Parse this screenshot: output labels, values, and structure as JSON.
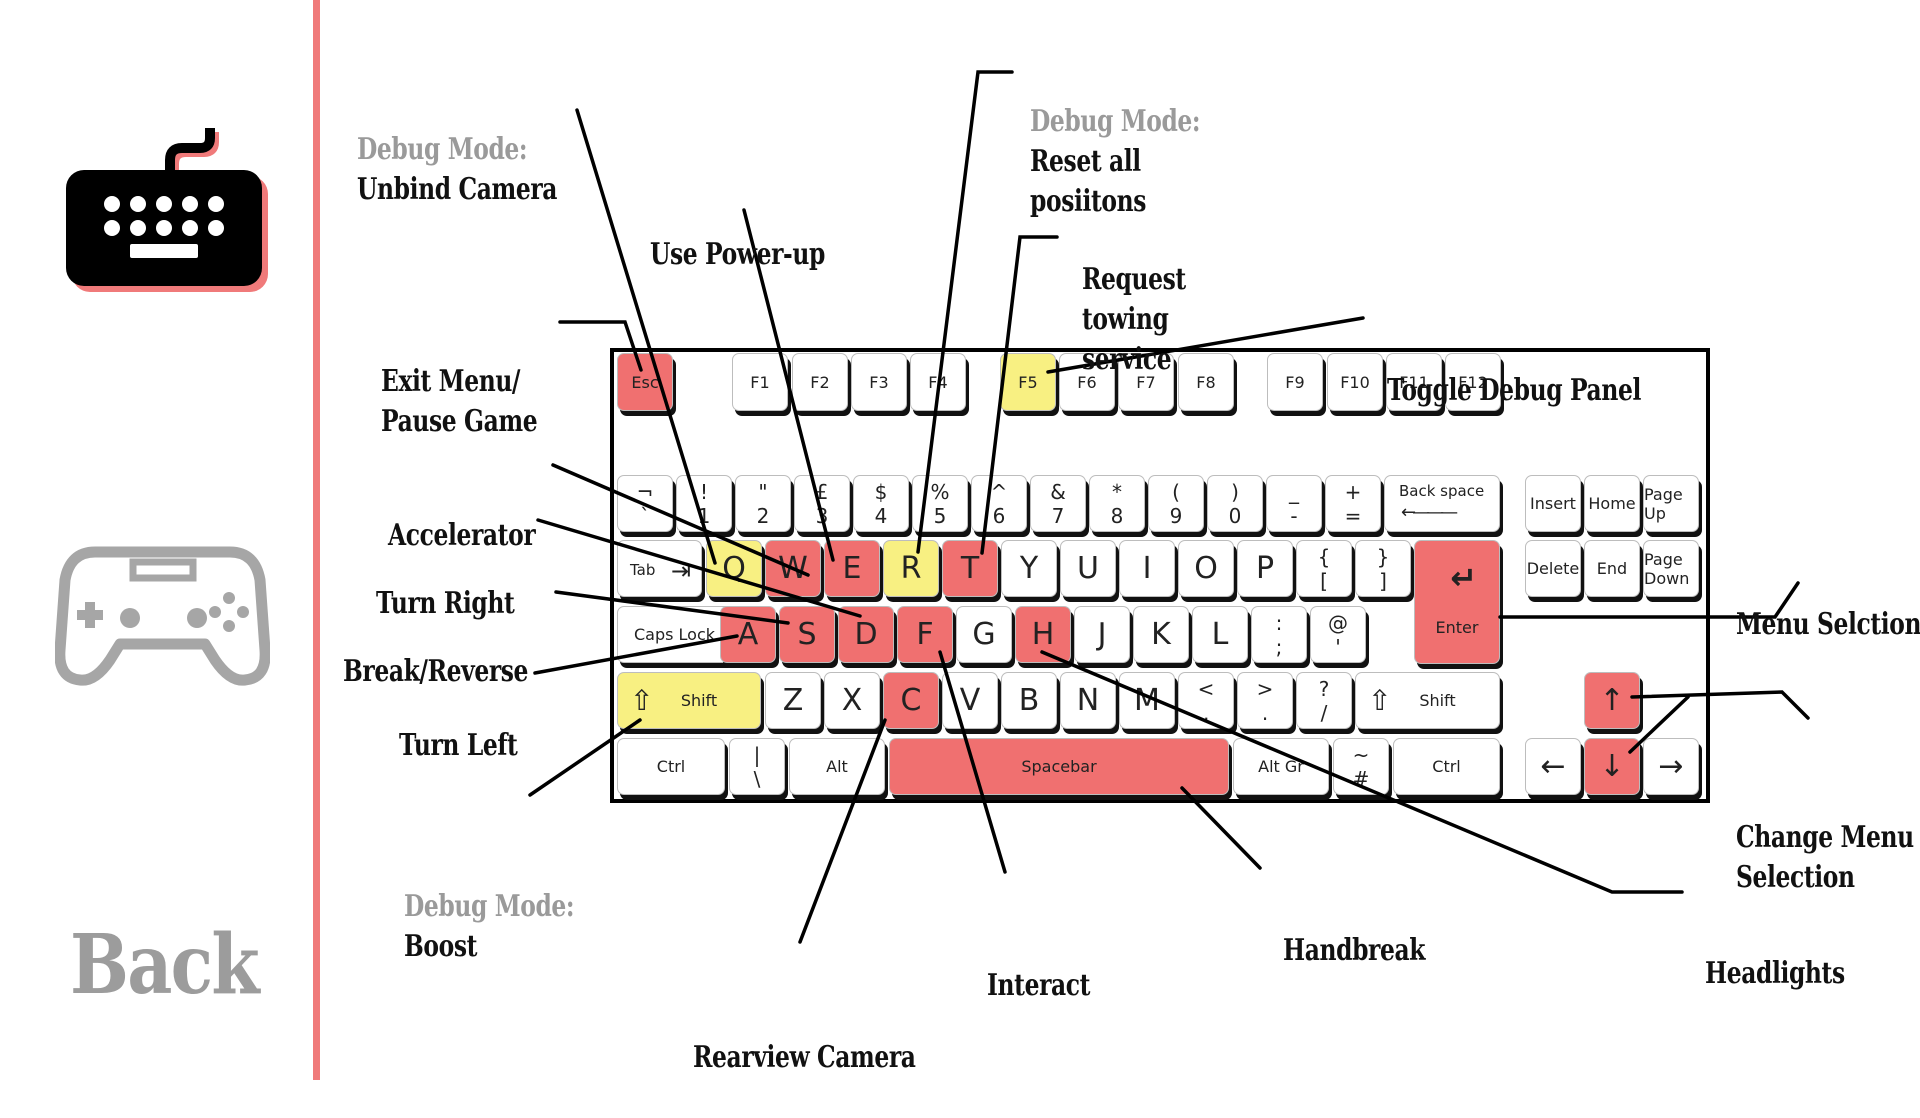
{
  "sidebar": {
    "keyboard_icon": "keyboard-icon",
    "gamepad_icon": "gamepad-icon",
    "back_label": "Back",
    "accent": "#f07a7a"
  },
  "colors": {
    "action_key": "#f07070",
    "debug_key": "#f8f082",
    "debug_text": "#9a9a9a"
  },
  "keyboard": {
    "keys": [
      {
        "id": "esc",
        "label": "Esc",
        "style": "small",
        "color": "red"
      },
      {
        "id": "f1",
        "label": "F1",
        "style": "small"
      },
      {
        "id": "f2",
        "label": "F2",
        "style": "small"
      },
      {
        "id": "f3",
        "label": "F3",
        "style": "small"
      },
      {
        "id": "f4",
        "label": "F4",
        "style": "small"
      },
      {
        "id": "f5",
        "label": "F5",
        "style": "small",
        "color": "yel"
      },
      {
        "id": "f6",
        "label": "F6",
        "style": "small"
      },
      {
        "id": "f7",
        "label": "F7",
        "style": "small"
      },
      {
        "id": "f8",
        "label": "F8",
        "style": "small"
      },
      {
        "id": "f9",
        "label": "F9",
        "style": "small"
      },
      {
        "id": "f10",
        "label": "F10",
        "style": "small"
      },
      {
        "id": "f11",
        "label": "F11",
        "style": "small"
      },
      {
        "id": "f12",
        "label": "F12",
        "style": "small"
      },
      {
        "id": "backtick",
        "top": "¬",
        "bottom": "`",
        "style": "dual"
      },
      {
        "id": "1",
        "top": "!",
        "bottom": "1",
        "style": "dual"
      },
      {
        "id": "2",
        "top": "\"",
        "bottom": "2",
        "style": "dual"
      },
      {
        "id": "3",
        "top": "£",
        "bottom": "3",
        "style": "dual"
      },
      {
        "id": "4",
        "top": "$",
        "bottom": "4",
        "style": "dual"
      },
      {
        "id": "5",
        "top": "%",
        "bottom": "5",
        "style": "dual"
      },
      {
        "id": "6",
        "top": "^",
        "bottom": "6",
        "style": "dual"
      },
      {
        "id": "7",
        "top": "&",
        "bottom": "7",
        "style": "dual"
      },
      {
        "id": "8",
        "top": "*",
        "bottom": "8",
        "style": "dual"
      },
      {
        "id": "9",
        "top": "(",
        "bottom": "9",
        "style": "dual"
      },
      {
        "id": "0",
        "top": ")",
        "bottom": "0",
        "style": "dual"
      },
      {
        "id": "minus",
        "top": "_",
        "bottom": "-",
        "style": "dual"
      },
      {
        "id": "equals",
        "top": "+",
        "bottom": "=",
        "style": "dual"
      },
      {
        "id": "backspace",
        "label": "Back space",
        "style": "backspace"
      },
      {
        "id": "insert",
        "label": "Insert",
        "style": "small"
      },
      {
        "id": "home",
        "label": "Home",
        "style": "small"
      },
      {
        "id": "pageup",
        "label": "Page Up",
        "style": "small"
      },
      {
        "id": "tab",
        "label": "Tab",
        "style": "tab"
      },
      {
        "id": "q",
        "label": "Q",
        "style": "single",
        "color": "yel"
      },
      {
        "id": "w",
        "label": "W",
        "style": "single",
        "color": "red"
      },
      {
        "id": "e",
        "label": "E",
        "style": "single",
        "color": "red"
      },
      {
        "id": "r",
        "label": "R",
        "style": "single",
        "color": "yel"
      },
      {
        "id": "t",
        "label": "T",
        "style": "single",
        "color": "red"
      },
      {
        "id": "y",
        "label": "Y",
        "style": "single"
      },
      {
        "id": "u",
        "label": "U",
        "style": "single"
      },
      {
        "id": "i",
        "label": "I",
        "style": "single"
      },
      {
        "id": "o",
        "label": "O",
        "style": "single"
      },
      {
        "id": "p",
        "label": "P",
        "style": "single"
      },
      {
        "id": "lbrace",
        "top": "{",
        "bottom": "[",
        "style": "dual"
      },
      {
        "id": "rbrace",
        "top": "}",
        "bottom": "]",
        "style": "dual"
      },
      {
        "id": "enter",
        "label": "Enter",
        "style": "enter",
        "color": "red"
      },
      {
        "id": "delete",
        "label": "Delete",
        "style": "small"
      },
      {
        "id": "end",
        "label": "End",
        "style": "small"
      },
      {
        "id": "pagedown",
        "label": "Page Down",
        "style": "small"
      },
      {
        "id": "capslock",
        "label": "Caps Lock",
        "style": "small"
      },
      {
        "id": "a",
        "label": "A",
        "style": "single",
        "color": "red"
      },
      {
        "id": "s",
        "label": "S",
        "style": "single",
        "color": "red"
      },
      {
        "id": "d",
        "label": "D",
        "style": "single",
        "color": "red"
      },
      {
        "id": "f",
        "label": "F",
        "style": "single",
        "color": "red"
      },
      {
        "id": "g",
        "label": "G",
        "style": "single"
      },
      {
        "id": "h",
        "label": "H",
        "style": "single",
        "color": "red"
      },
      {
        "id": "j",
        "label": "J",
        "style": "single"
      },
      {
        "id": "k",
        "label": "K",
        "style": "single"
      },
      {
        "id": "l",
        "label": "L",
        "style": "single"
      },
      {
        "id": "semicolon",
        "top": ":",
        "bottom": ";",
        "style": "dual"
      },
      {
        "id": "quote",
        "top": "@",
        "bottom": "'",
        "style": "dual"
      },
      {
        "id": "lshift",
        "label": "Shift",
        "style": "shift",
        "color": "yel"
      },
      {
        "id": "z",
        "label": "Z",
        "style": "single"
      },
      {
        "id": "x",
        "label": "X",
        "style": "single"
      },
      {
        "id": "c",
        "label": "C",
        "style": "single",
        "color": "red"
      },
      {
        "id": "v",
        "label": "V",
        "style": "single"
      },
      {
        "id": "b",
        "label": "B",
        "style": "single"
      },
      {
        "id": "n",
        "label": "N",
        "style": "single"
      },
      {
        "id": "m",
        "label": "M",
        "style": "single"
      },
      {
        "id": "comma",
        "top": "<",
        "bottom": ",",
        "style": "dual"
      },
      {
        "id": "period",
        "top": ">",
        "bottom": ".",
        "style": "dual"
      },
      {
        "id": "slash",
        "top": "?",
        "bottom": "/",
        "style": "dual"
      },
      {
        "id": "rshift",
        "label": "Shift",
        "style": "shift"
      },
      {
        "id": "up",
        "label": "↑",
        "style": "arrow",
        "color": "red"
      },
      {
        "id": "lctrl",
        "label": "Ctrl",
        "style": "small"
      },
      {
        "id": "pipe",
        "top": "|",
        "bottom": "\\",
        "style": "dual"
      },
      {
        "id": "alt",
        "label": "Alt",
        "style": "small"
      },
      {
        "id": "space",
        "label": "Spacebar",
        "style": "small",
        "color": "red"
      },
      {
        "id": "altgr",
        "label": "Alt Gr",
        "style": "small"
      },
      {
        "id": "hash",
        "top": "~",
        "bottom": "#",
        "style": "dual"
      },
      {
        "id": "rctrl",
        "label": "Ctrl",
        "style": "small"
      },
      {
        "id": "left",
        "label": "←",
        "style": "arrow"
      },
      {
        "id": "down",
        "label": "↓",
        "style": "arrow",
        "color": "red"
      },
      {
        "id": "right",
        "label": "→",
        "style": "arrow"
      }
    ]
  },
  "labels": [
    {
      "id": "unbind-camera",
      "debug": "Debug Mode:",
      "text": "Unbind Camera"
    },
    {
      "id": "use-powerup",
      "text": "Use Power-up"
    },
    {
      "id": "reset-positions",
      "debug": "Debug Mode:",
      "text": "Reset all\nposiitons"
    },
    {
      "id": "request-towing",
      "text": "Request\ntowing\nservice"
    },
    {
      "id": "exit-menu",
      "text": "Exit Menu/\nPause Game"
    },
    {
      "id": "toggle-debug",
      "text": "Toggle Debug Panel"
    },
    {
      "id": "accelerator",
      "text": "Accelerator"
    },
    {
      "id": "turn-right",
      "text": "Turn Right"
    },
    {
      "id": "break-reverse",
      "text": "Break/Reverse"
    },
    {
      "id": "turn-left",
      "text": "Turn Left"
    },
    {
      "id": "boost",
      "debug": "Debug Mode:",
      "text": "Boost"
    },
    {
      "id": "interact",
      "text": "Interact"
    },
    {
      "id": "rearview-camera",
      "text": "Rearview Camera"
    },
    {
      "id": "handbreak",
      "text": "Handbreak"
    },
    {
      "id": "headlights",
      "text": "Headlights"
    },
    {
      "id": "menu-selection",
      "text": "Menu Selction"
    },
    {
      "id": "change-menu-selection",
      "text": "Change Menu\nSelection"
    }
  ]
}
